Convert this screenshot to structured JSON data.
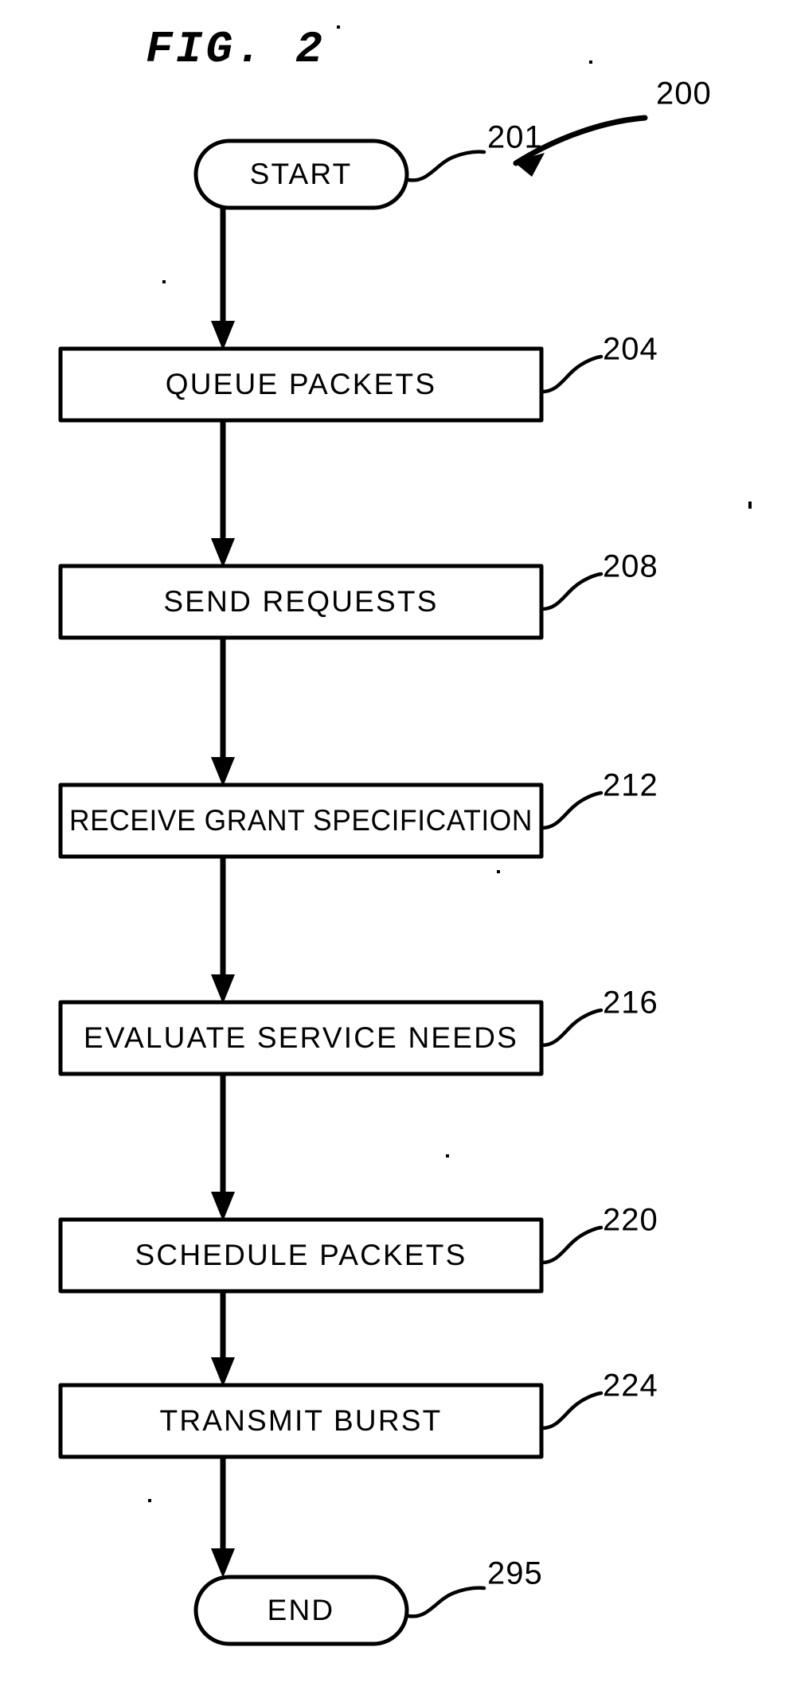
{
  "figure": {
    "title": "FIG. 2",
    "overall_reference": "200",
    "background_color": "#ffffff",
    "ink_color": "#000000"
  },
  "nodes": [
    {
      "id": "start",
      "shape": "terminator",
      "label": "START",
      "reference": "201"
    },
    {
      "id": "s204",
      "shape": "process",
      "label": "QUEUE PACKETS",
      "reference": "204"
    },
    {
      "id": "s208",
      "shape": "process",
      "label": "SEND REQUESTS",
      "reference": "208"
    },
    {
      "id": "s212",
      "shape": "process",
      "label": "RECEIVE GRANT SPECIFICATION",
      "reference": "212"
    },
    {
      "id": "s216",
      "shape": "process",
      "label": "EVALUATE SERVICE NEEDS",
      "reference": "216"
    },
    {
      "id": "s220",
      "shape": "process",
      "label": "SCHEDULE PACKETS",
      "reference": "220"
    },
    {
      "id": "s224",
      "shape": "process",
      "label": "TRANSMIT BURST",
      "reference": "224"
    },
    {
      "id": "end",
      "shape": "terminator",
      "label": "END",
      "reference": "295"
    }
  ],
  "flow_order": [
    "start",
    "s204",
    "s208",
    "s212",
    "s216",
    "s220",
    "s224",
    "end"
  ]
}
